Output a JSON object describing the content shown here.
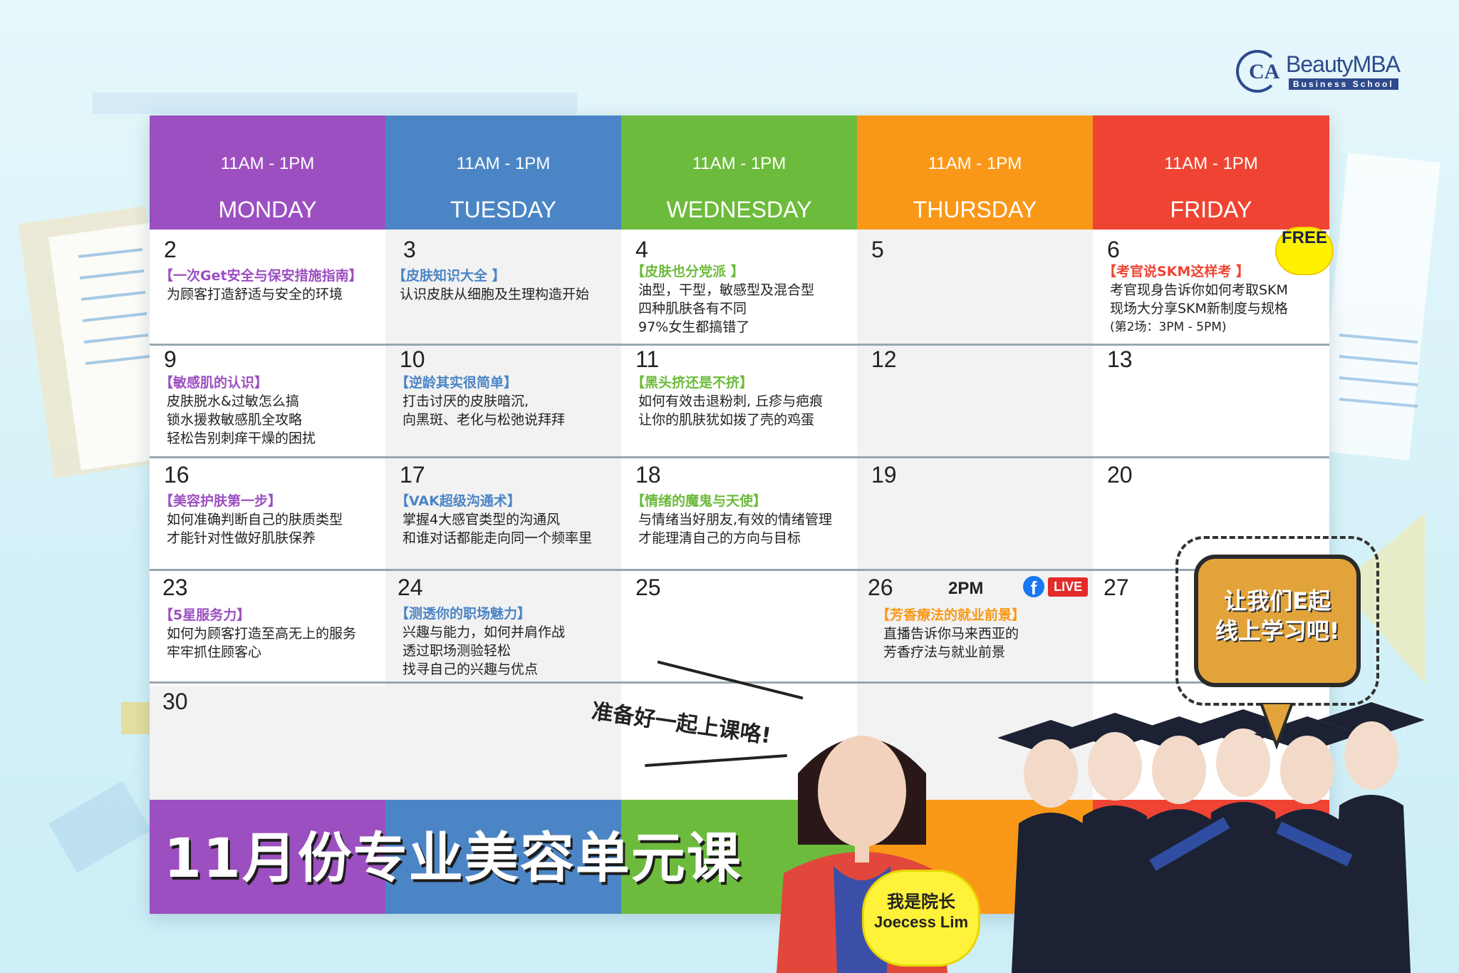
{
  "logo": {
    "mark": "CA",
    "name": "BeautyMBA",
    "sub": "Business School"
  },
  "days": [
    {
      "time": "11AM - 1PM",
      "name": "MONDAY",
      "color": "#9c4fc0"
    },
    {
      "time": "11AM - 1PM",
      "name": "TUESDAY",
      "color": "#4c85c5"
    },
    {
      "time": "11AM - 1PM",
      "name": "WEDNESDAY",
      "color": "#6dbb3c"
    },
    {
      "time": "11AM - 1PM",
      "name": "THURSDAY",
      "color": "#f99818"
    },
    {
      "time": "11AM - 1PM",
      "name": "FRIDAY",
      "color": "#ef4433"
    }
  ],
  "weeks": [
    [
      {
        "date": "2",
        "title": "【一次Get安全与保安措施指南】",
        "lines": [
          "为顾客打造舒适与安全的环境"
        ],
        "title_color": "#9c4fc0"
      },
      {
        "date": "3",
        "title": "【皮肤知识大全 】",
        "lines": [
          "认识皮肤从细胞及生理构造开始"
        ],
        "title_color": "#4c85c5"
      },
      {
        "date": "4",
        "title": "【皮肤也分党派 】",
        "lines": [
          "油型，干型，敏感型及混合型",
          "四种肌肤各有不同",
          "97%女生都搞错了"
        ],
        "title_color": "#6dbb3c"
      },
      {
        "date": "5"
      },
      {
        "date": "6",
        "title": "【考官说SKM这样考 】",
        "lines": [
          "考官现身告诉你如何考取SKM",
          "现场大分享SKM新制度与规格"
        ],
        "note": "(第2场：3PM - 5PM)",
        "title_color": "#ef4433"
      }
    ],
    [
      {
        "date": "9",
        "title": "【敏感肌的认识】",
        "lines": [
          "皮肤脱水&过敏怎么搞",
          "锁水援救敏感肌全攻略",
          "轻松告别刺痒干燥的困扰"
        ],
        "title_color": "#9c4fc0"
      },
      {
        "date": "10",
        "title": "【逆龄其实很简单】",
        "lines": [
          "打击讨厌的皮肤暗沉,",
          "向黑斑、老化与松弛说拜拜"
        ],
        "title_color": "#4c85c5"
      },
      {
        "date": "11",
        "title": "【黑头挤还是不挤】",
        "lines": [
          "如何有效击退粉刺, 丘疹与疤痕",
          "让你的肌肤犹如拨了壳的鸡蛋"
        ],
        "title_color": "#6dbb3c"
      },
      {
        "date": "12"
      },
      {
        "date": "13"
      }
    ],
    [
      {
        "date": "16",
        "title": "【美容护肤第一步】",
        "lines": [
          "如何准确判断自己的肤质类型",
          "才能针对性做好肌肤保养"
        ],
        "title_color": "#9c4fc0"
      },
      {
        "date": "17",
        "title": "【VAK超级沟通术】",
        "lines": [
          "掌握4大感官类型的沟通风",
          "和谁对话都能走向同一个频率里"
        ],
        "title_color": "#4c85c5"
      },
      {
        "date": "18",
        "title": "【情绪的魔鬼与天使】",
        "lines": [
          "与情绪当好朋友,有效的情绪管理",
          "才能理清自己的方向与目标"
        ],
        "title_color": "#6dbb3c"
      },
      {
        "date": "19"
      },
      {
        "date": "20"
      }
    ],
    [
      {
        "date": "23",
        "title": "【5星服务力】",
        "lines": [
          "如何为顾客打造至高无上的服务",
          "牢牢抓住顾客心"
        ],
        "title_color": "#9c4fc0"
      },
      {
        "date": "24",
        "title": "【测透你的职场魅力】",
        "lines": [
          "兴趣与能力，如何并肩作战",
          "透过职场测验轻松",
          "找寻自己的兴趣与优点"
        ],
        "title_color": "#4c85c5"
      },
      {
        "date": "25"
      },
      {
        "date": "26",
        "title": "【芳香療法的就业前景】",
        "lines": [
          "直播告诉你马来西亚的",
          "芳香疗法与就业前景"
        ],
        "title_color": "#f99818"
      },
      {
        "date": "27"
      }
    ],
    [
      {
        "date": "30"
      }
    ]
  ],
  "free_badge": "FREE",
  "live_time": "2PM",
  "live_icon": "f",
  "live_label": "LIVE",
  "footer_title": "11月份专业美容单元课",
  "ready_text": "准备好一起上课咯!",
  "speech": {
    "line1": "让我们E起",
    "line2": "线上学习吧!"
  },
  "principal": {
    "line1": "我是院长",
    "line2": "Joecess Lim"
  }
}
